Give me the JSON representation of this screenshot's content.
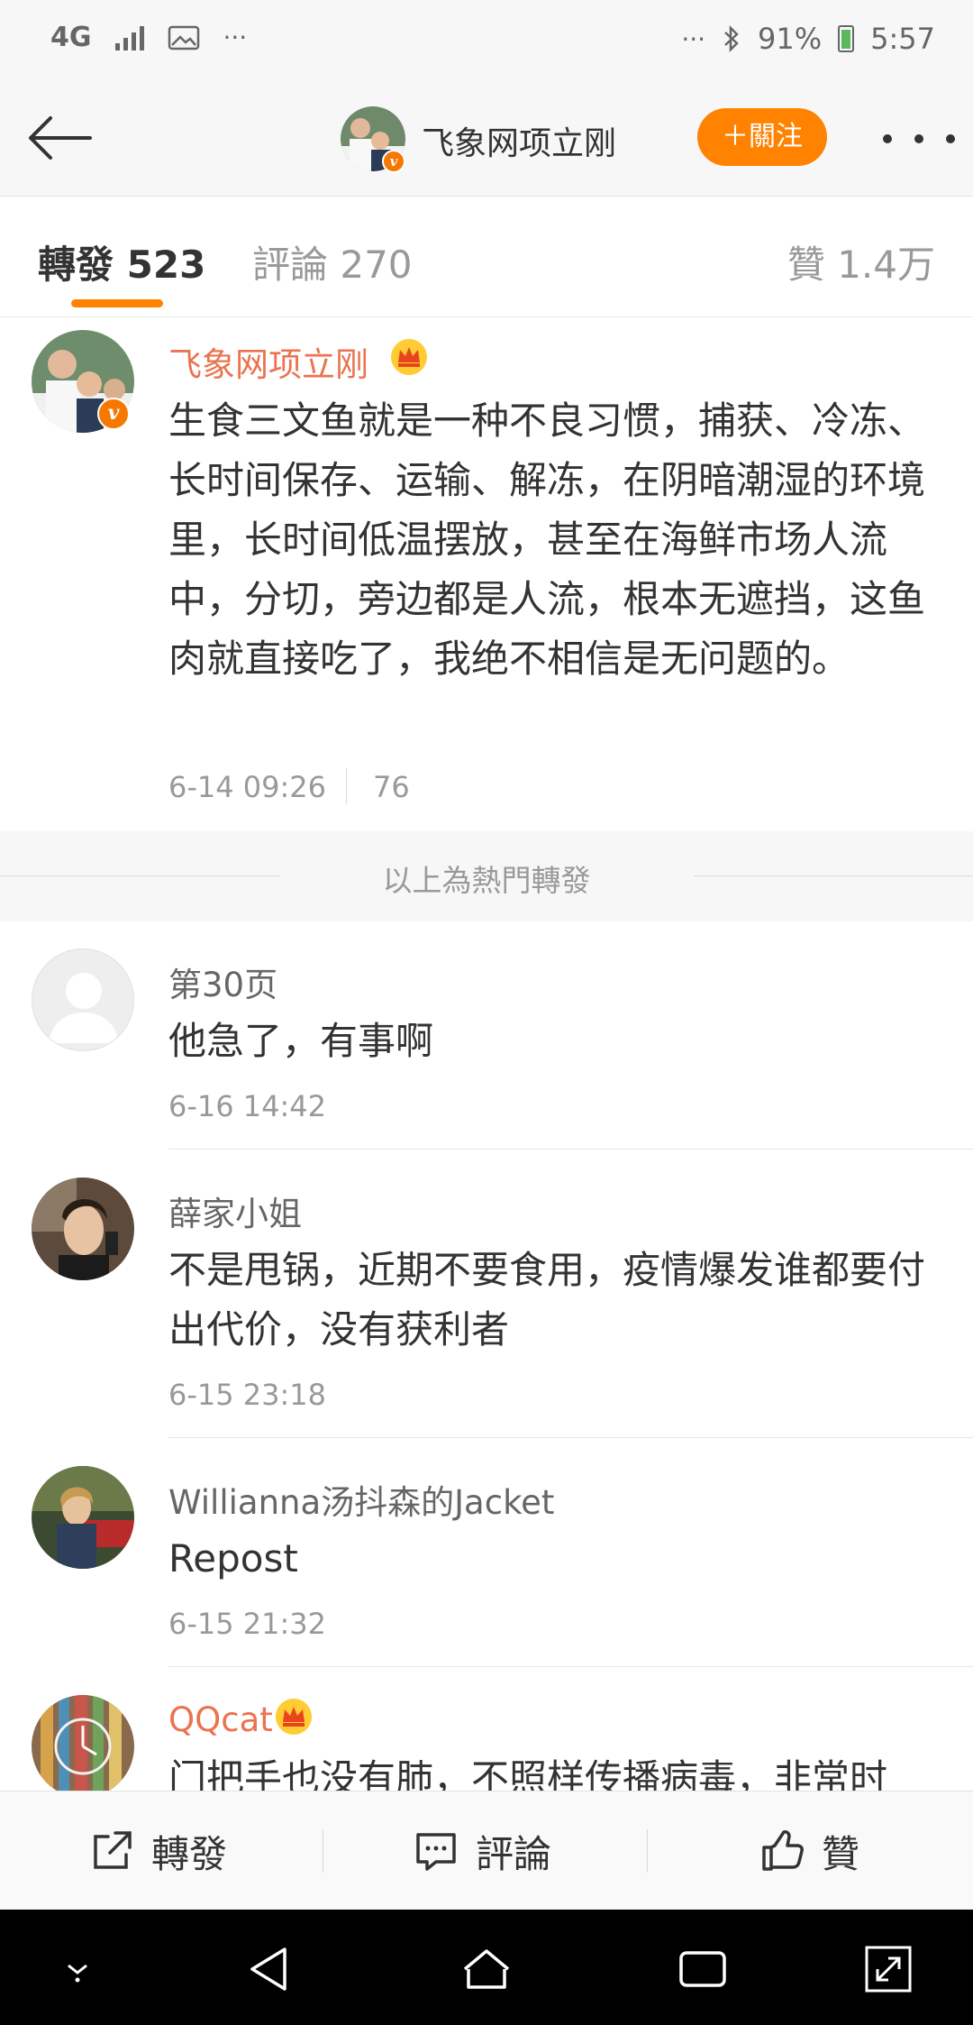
{
  "status_bar": {
    "network": "4G",
    "battery": "91%",
    "time": "5:57",
    "icons": [
      "signal-icon",
      "gallery-icon",
      "more-dots-icon",
      "bluetooth-icon",
      "battery-icon"
    ]
  },
  "header": {
    "name": "飞象网项立刚",
    "follow_label": "＋關注",
    "verify_mark": "v"
  },
  "tabs": {
    "repost": "轉發 523",
    "comment": "評論 270",
    "like": "贊 1.4万"
  },
  "hot_post": {
    "name": "飞象网项立刚",
    "text": "生食三文鱼就是一种不良习惯，捕获、冷冻、长时间保存、运输、解冻，在阴暗潮湿的环境里，长时间低温摆放，甚至在海鲜市场人流中，分切，旁边都是人流，根本无遮挡，这鱼肉就直接吃了，我绝不相信是无问题的。",
    "time": "6-14 09:26",
    "likes": "76"
  },
  "hot_divider": "以上為熱門轉發",
  "reposts": [
    {
      "name": "第30页",
      "text": "他急了，有事啊",
      "time": "6-16 14:42"
    },
    {
      "name": "薛家小姐",
      "text": "不是甩锅，近期不要食用，疫情爆发谁都要付出代价，没有获利者",
      "time": "6-15 23:18"
    },
    {
      "name": "Willianna汤抖森的Jacket",
      "text": "Repost",
      "time": "6-15 21:32"
    },
    {
      "name": "QQcat",
      "text": "门把手也没有肺，不照样传播病毒，非常时"
    }
  ],
  "action_bar": {
    "repost": "轉發",
    "comment": "評論",
    "like": "贊"
  },
  "colors": {
    "accent": "#ff8200",
    "vip_name": "#eb7350",
    "secondary_text": "#999999"
  }
}
